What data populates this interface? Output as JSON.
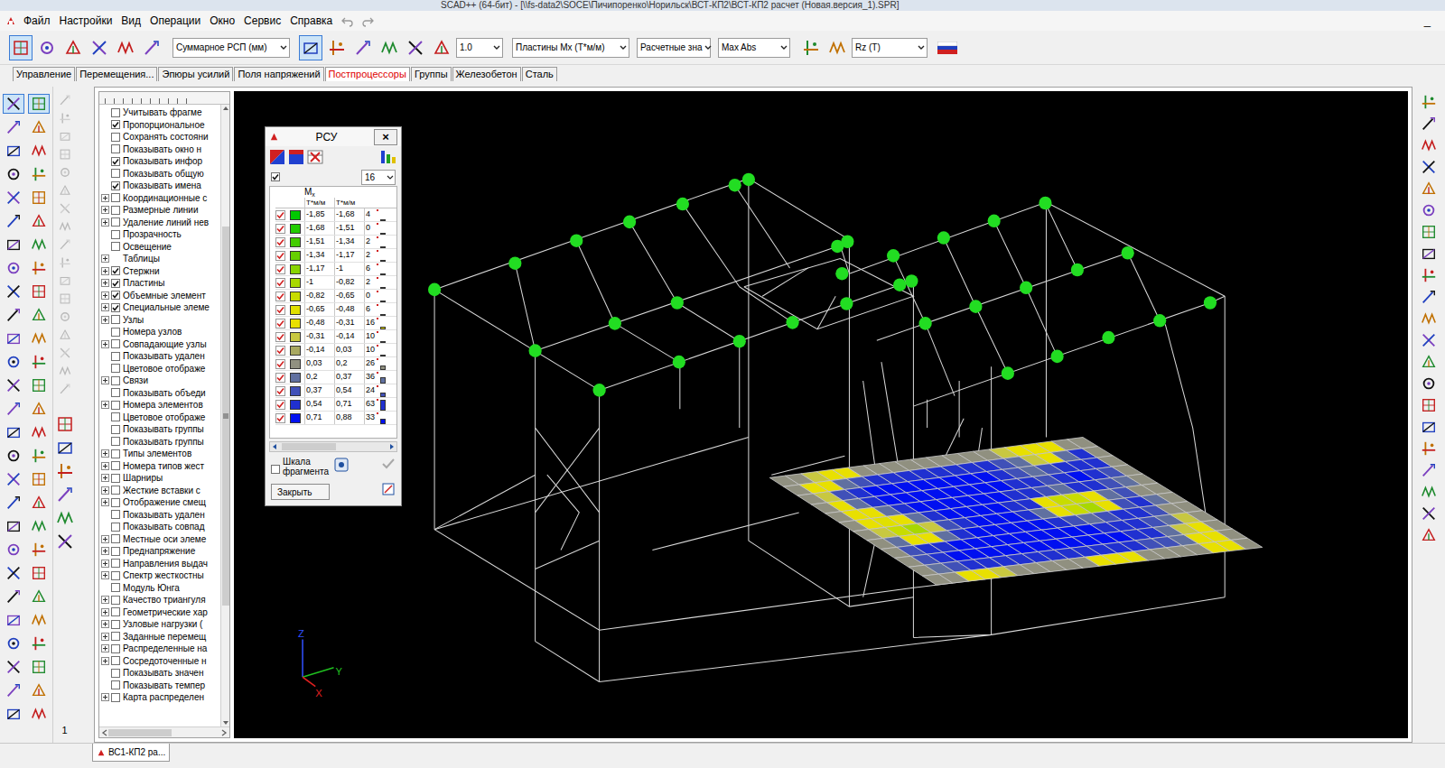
{
  "window": {
    "title": "SCAD++ (64-бит) - [\\\\fs-data2\\SOCE\\Пичипоренко\\Норильск\\ВСТ-КП2\\ВСТ-КП2 расчет (Новая.версия_1).SPR]"
  },
  "menu": [
    "Файл",
    "Настройки",
    "Вид",
    "Операции",
    "Окно",
    "Сервис",
    "Справка"
  ],
  "window_controls": [
    "_"
  ],
  "toolbar": {
    "result_select": "Суммарное РСП (мм)",
    "scale": "1.0",
    "factor_select": "Пластины Mx (Т*м/м)",
    "values_select": "Расчетные зна",
    "mode_select": "Max Abs",
    "reaction_select": "Rz (Т)",
    "buttons_pressed": [
      true,
      false,
      false,
      false,
      false,
      false,
      true,
      false,
      false,
      false,
      false,
      false,
      false,
      false
    ]
  },
  "tabs": [
    {
      "label": "Управление",
      "selected": false
    },
    {
      "label": "Перемещения...",
      "selected": false
    },
    {
      "label": "Эпюры усилий",
      "selected": false
    },
    {
      "label": "Поля напряжений",
      "selected": false
    },
    {
      "label": "Постпроцессоры",
      "selected": true
    },
    {
      "label": "Группы",
      "selected": false
    },
    {
      "label": "Железобетон",
      "selected": false
    },
    {
      "label": "Сталь",
      "selected": false
    }
  ],
  "palette_pressed": [
    true,
    true,
    false,
    false,
    false,
    false,
    false,
    false,
    false,
    false,
    false,
    false,
    false,
    false,
    false,
    false,
    false,
    false,
    false,
    false,
    false,
    false,
    false,
    false,
    false,
    false,
    false,
    false,
    false,
    false,
    false,
    false,
    false,
    false,
    false,
    false,
    false,
    false,
    false,
    false,
    false,
    false,
    false,
    false,
    false,
    false,
    false,
    false,
    false,
    false,
    false,
    false,
    false,
    false
  ],
  "palette_page": "1",
  "tree": {
    "items": [
      {
        "label": "Учитывать фрагме",
        "kind": "check",
        "expander": false,
        "checked": false
      },
      {
        "label": "Пропорциональное",
        "kind": "check",
        "expander": false,
        "checked": true
      },
      {
        "label": "Сохранять состояни",
        "kind": "check",
        "expander": false,
        "checked": false
      },
      {
        "label": "Показывать окно н",
        "kind": "check",
        "expander": false,
        "checked": false
      },
      {
        "label": "Показывать инфор",
        "kind": "check",
        "expander": false,
        "checked": true
      },
      {
        "label": "Показывать общую",
        "kind": "check",
        "expander": false,
        "checked": false
      },
      {
        "label": "Показывать имена",
        "kind": "check",
        "expander": false,
        "checked": true
      },
      {
        "label": "Координационные с",
        "kind": "check",
        "expander": true,
        "checked": false
      },
      {
        "label": "Размерные линии",
        "kind": "check",
        "expander": true,
        "checked": false
      },
      {
        "label": "Удаление линий нев",
        "kind": "check",
        "expander": true,
        "checked": false
      },
      {
        "label": "Прозрачность",
        "kind": "check",
        "expander": false,
        "checked": false
      },
      {
        "label": "Освещение",
        "kind": "check",
        "expander": false,
        "checked": false
      },
      {
        "label": "Таблицы",
        "kind": "group",
        "expander": true
      },
      {
        "label": "Стержни",
        "kind": "check",
        "expander": true,
        "checked": true
      },
      {
        "label": "Пластины",
        "kind": "check",
        "expander": true,
        "checked": true
      },
      {
        "label": "Объемные элемент",
        "kind": "check",
        "expander": true,
        "checked": true
      },
      {
        "label": "Специальные элеме",
        "kind": "check",
        "expander": true,
        "checked": true
      },
      {
        "label": "Узлы",
        "kind": "check",
        "expander": true,
        "checked": false
      },
      {
        "label": "Номера узлов",
        "kind": "check",
        "expander": false,
        "checked": false
      },
      {
        "label": "Совпадающие узлы",
        "kind": "check",
        "expander": true,
        "checked": false
      },
      {
        "label": "Показывать удален",
        "kind": "check",
        "expander": false,
        "checked": false
      },
      {
        "label": "Цветовое отображе",
        "kind": "check",
        "expander": false,
        "checked": false
      },
      {
        "label": "Связи",
        "kind": "check",
        "expander": true,
        "checked": false
      },
      {
        "label": "Показывать объеди",
        "kind": "check",
        "expander": false,
        "checked": false
      },
      {
        "label": "Номера элементов",
        "kind": "check",
        "expander": true,
        "checked": false
      },
      {
        "label": "Цветовое отображе",
        "kind": "check",
        "expander": false,
        "checked": false
      },
      {
        "label": "Показывать группы",
        "kind": "check",
        "expander": false,
        "checked": false
      },
      {
        "label": "Показывать группы",
        "kind": "check",
        "expander": false,
        "checked": false
      },
      {
        "label": "Типы элементов",
        "kind": "check",
        "expander": true,
        "checked": false
      },
      {
        "label": "Номера типов жест",
        "kind": "check",
        "expander": true,
        "checked": false
      },
      {
        "label": "Шарниры",
        "kind": "check",
        "expander": true,
        "checked": false
      },
      {
        "label": "Жесткие вставки с",
        "kind": "check",
        "expander": true,
        "checked": false
      },
      {
        "label": "Отображение смещ",
        "kind": "check",
        "expander": true,
        "checked": false
      },
      {
        "label": "Показывать удален",
        "kind": "check",
        "expander": false,
        "checked": false
      },
      {
        "label": "Показывать совпад",
        "kind": "check",
        "expander": false,
        "checked": false
      },
      {
        "label": "Местные оси элеме",
        "kind": "check",
        "expander": true,
        "checked": false
      },
      {
        "label": "Преднапряжение",
        "kind": "check",
        "expander": true,
        "checked": false
      },
      {
        "label": "Направления выдач",
        "kind": "check",
        "expander": true,
        "checked": false
      },
      {
        "label": "Спектр жесткостны",
        "kind": "check",
        "expander": true,
        "checked": false
      },
      {
        "label": "Модуль Юнга",
        "kind": "check",
        "expander": false,
        "checked": false
      },
      {
        "label": "Качество триангуля",
        "kind": "check",
        "expander": true,
        "checked": false
      },
      {
        "label": "Геометрические хар",
        "kind": "check",
        "expander": true,
        "checked": false
      },
      {
        "label": "Узловые нагрузки (",
        "kind": "check",
        "expander": true,
        "checked": false
      },
      {
        "label": "Заданные перемещ",
        "kind": "check",
        "expander": true,
        "checked": false
      },
      {
        "label": "Распределенные на",
        "kind": "check",
        "expander": true,
        "checked": false
      },
      {
        "label": "Сосредоточенные н",
        "kind": "check",
        "expander": true,
        "checked": false
      },
      {
        "label": "Показывать значен",
        "kind": "check",
        "expander": false,
        "checked": false
      },
      {
        "label": "Показывать темпер",
        "kind": "check",
        "expander": false,
        "checked": false
      },
      {
        "label": "Карта распределен",
        "kind": "check",
        "expander": true,
        "checked": false
      }
    ]
  },
  "rsu": {
    "title": "РСУ",
    "close": "×",
    "show_checked": true,
    "count_select": "16",
    "header": {
      "symbol": "M",
      "subscript": "x",
      "units": [
        "Т*м/м",
        "Т*м/м"
      ]
    },
    "rows": [
      {
        "from": "-1,85",
        "to": "-1,68",
        "count": "4",
        "level": 0.06,
        "checked": true,
        "color": "#00c800"
      },
      {
        "from": "-1,68",
        "to": "-1,51",
        "count": "0",
        "level": 0.0,
        "checked": true,
        "color": "#22cc00"
      },
      {
        "from": "-1,51",
        "to": "-1,34",
        "count": "2",
        "level": 0.03,
        "checked": true,
        "color": "#44cc00"
      },
      {
        "from": "-1,34",
        "to": "-1,17",
        "count": "2",
        "level": 0.03,
        "checked": true,
        "color": "#66d000"
      },
      {
        "from": "-1,17",
        "to": "-1",
        "count": "6",
        "level": 0.1,
        "checked": true,
        "color": "#88d400"
      },
      {
        "from": "-1",
        "to": "-0,82",
        "count": "2",
        "level": 0.03,
        "checked": true,
        "color": "#a8d800"
      },
      {
        "from": "-0,82",
        "to": "-0,65",
        "count": "0",
        "level": 0.0,
        "checked": true,
        "color": "#c8dc00"
      },
      {
        "from": "-0,65",
        "to": "-0,48",
        "count": "6",
        "level": 0.1,
        "checked": true,
        "color": "#e0e000"
      },
      {
        "from": "-0,48",
        "to": "-0,31",
        "count": "16",
        "level": 0.25,
        "checked": true,
        "color": "#e8e000"
      },
      {
        "from": "-0,31",
        "to": "-0,14",
        "count": "10",
        "level": 0.16,
        "checked": true,
        "color": "#c8c840"
      },
      {
        "from": "-0,14",
        "to": "0,03",
        "count": "10",
        "level": 0.16,
        "checked": true,
        "color": "#a8a860"
      },
      {
        "from": "0,03",
        "to": "0,2",
        "count": "26",
        "level": 0.41,
        "checked": true,
        "color": "#909080"
      },
      {
        "from": "0,2",
        "to": "0,37",
        "count": "36",
        "level": 0.57,
        "checked": true,
        "color": "#6070a0"
      },
      {
        "from": "0,37",
        "to": "0,54",
        "count": "24",
        "level": 0.38,
        "checked": true,
        "color": "#4050b8"
      },
      {
        "from": "0,54",
        "to": "0,71",
        "count": "63",
        "level": 1.0,
        "checked": true,
        "color": "#2030d0"
      },
      {
        "from": "0,71",
        "to": "0,88",
        "count": "33",
        "level": 0.52,
        "checked": true,
        "color": "#0010f0"
      }
    ],
    "scale_label": "Шкала фрагмента",
    "scale_checked": false,
    "close_button": "Закрыть"
  },
  "viewport": {
    "axes": [
      "X",
      "Y",
      "Z"
    ],
    "plate_mesh": [
      [
        11,
        11,
        9,
        8,
        8,
        11,
        11,
        11,
        11,
        11,
        11,
        11,
        11,
        11,
        9,
        8,
        8,
        8,
        11,
        11
      ],
      [
        11,
        8,
        8,
        12,
        13,
        14,
        14,
        14,
        14,
        14,
        14,
        14,
        14,
        13,
        12,
        9,
        8,
        12,
        14,
        11
      ],
      [
        11,
        9,
        13,
        14,
        15,
        15,
        15,
        15,
        15,
        15,
        15,
        15,
        14,
        13,
        12,
        13,
        14,
        14,
        14,
        11
      ],
      [
        11,
        8,
        12,
        14,
        15,
        15,
        15,
        15,
        15,
        15,
        15,
        15,
        14,
        14,
        13,
        14,
        15,
        14,
        13,
        11
      ],
      [
        11,
        8,
        8,
        12,
        14,
        15,
        15,
        15,
        15,
        15,
        15,
        14,
        14,
        13,
        12,
        14,
        14,
        13,
        12,
        11
      ],
      [
        11,
        8,
        7,
        8,
        12,
        14,
        15,
        15,
        15,
        15,
        14,
        14,
        8,
        6,
        6,
        8,
        12,
        13,
        11,
        11
      ],
      [
        11,
        9,
        6,
        5,
        9,
        13,
        14,
        15,
        15,
        15,
        14,
        12,
        8,
        6,
        5,
        8,
        13,
        14,
        12,
        11
      ],
      [
        11,
        12,
        8,
        8,
        12,
        14,
        15,
        15,
        15,
        15,
        15,
        14,
        13,
        12,
        13,
        14,
        14,
        13,
        11,
        11
      ],
      [
        11,
        13,
        14,
        14,
        15,
        15,
        15,
        15,
        15,
        15,
        15,
        15,
        15,
        14,
        14,
        14,
        13,
        12,
        9,
        11
      ],
      [
        11,
        13,
        14,
        15,
        15,
        15,
        15,
        15,
        15,
        15,
        15,
        15,
        15,
        15,
        14,
        14,
        12,
        9,
        8,
        11
      ],
      [
        11,
        12,
        13,
        14,
        14,
        14,
        14,
        14,
        14,
        14,
        14,
        14,
        14,
        14,
        13,
        13,
        12,
        8,
        8,
        11
      ],
      [
        11,
        11,
        8,
        8,
        9,
        11,
        11,
        11,
        11,
        11,
        8,
        8,
        8,
        11,
        11,
        11,
        11,
        8,
        8,
        11
      ]
    ]
  },
  "documents": [
    {
      "label": "ВС1-КП2 ра...",
      "selected": true
    }
  ]
}
